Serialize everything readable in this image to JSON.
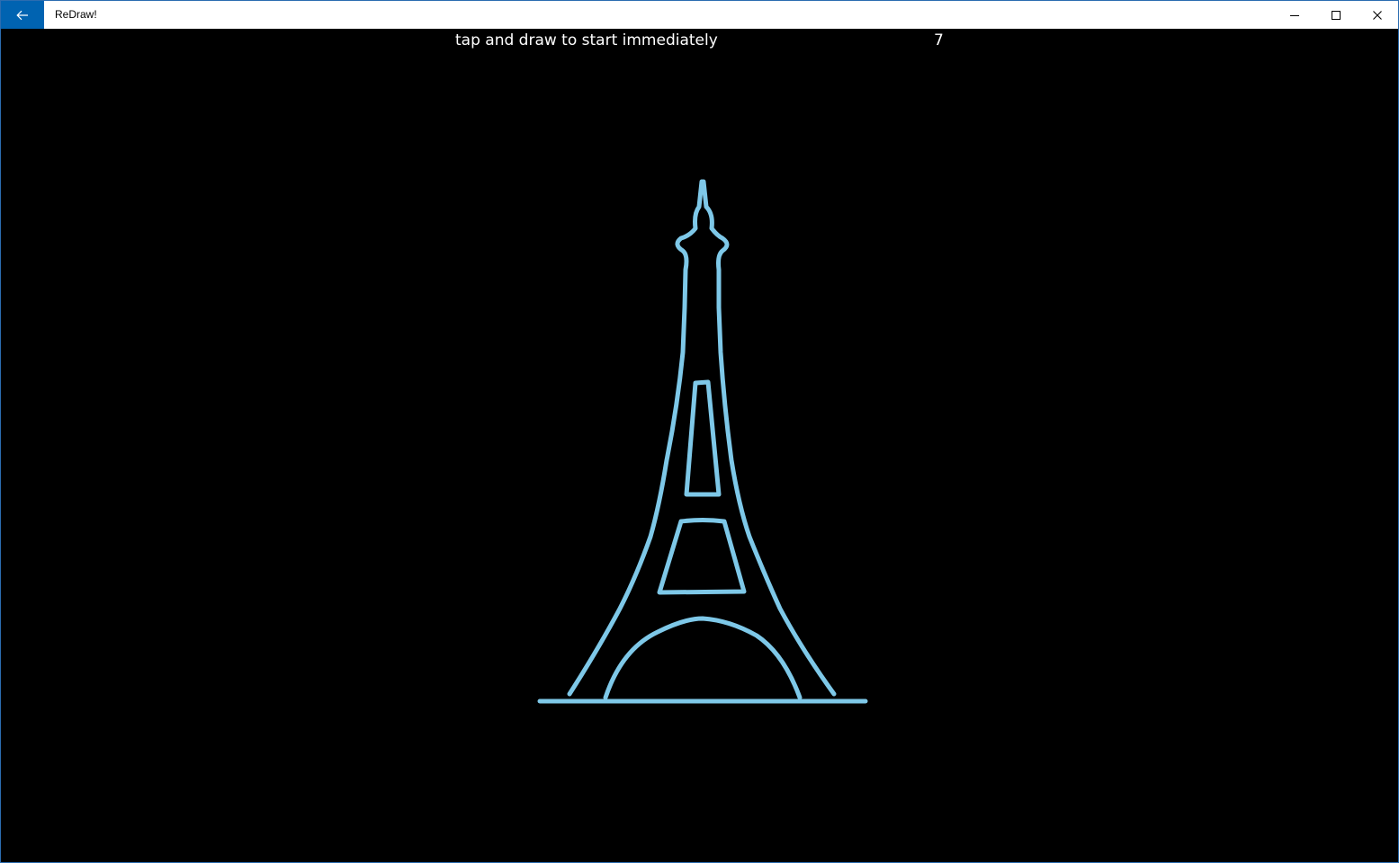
{
  "window": {
    "title": "ReDraw!"
  },
  "titlebar": {
    "back_icon": "arrow-left-icon",
    "minimize_icon": "minimize-icon",
    "maximize_icon": "maximize-icon",
    "close_icon": "close-icon"
  },
  "canvas": {
    "prompt": "tap and draw to start immediately",
    "countdown": "7",
    "stroke_color": "#7ec8e8",
    "background_color": "#000000"
  }
}
